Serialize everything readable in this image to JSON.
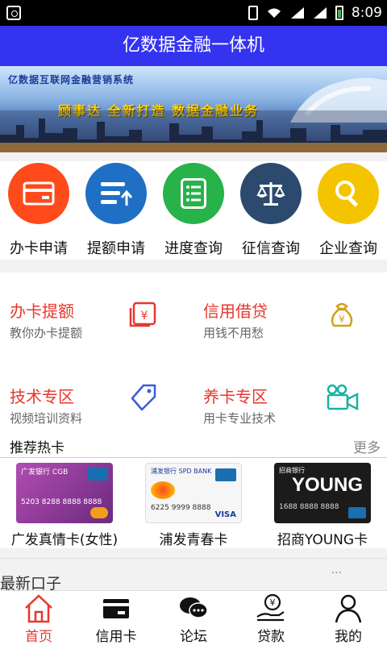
{
  "status_bar": {
    "time": "8:09"
  },
  "app_title": "亿数据金融一体机",
  "banner": {
    "title": "亿数据互联网金融营销系统",
    "slogan": "顾事达  全新打造  数据金融业务"
  },
  "quick_actions": [
    {
      "label": "办卡申请",
      "icon": "card-icon",
      "color": "#ff4a1c"
    },
    {
      "label": "提额申请",
      "icon": "raise-limit-icon",
      "color": "#1f6fc5"
    },
    {
      "label": "进度查询",
      "icon": "list-icon",
      "color": "#27b24a"
    },
    {
      "label": "征信查询",
      "icon": "scale-icon",
      "color": "#2b4a6e"
    },
    {
      "label": "企业查询",
      "icon": "search-icon",
      "color": "#f5c400"
    }
  ],
  "services": [
    {
      "title": "办卡提额",
      "subtitle": "教你办卡提额",
      "icon": "yen-card-icon",
      "icon_color": "#e8362c"
    },
    {
      "title": "信用借贷",
      "subtitle": "用钱不用愁",
      "icon": "money-bag-icon",
      "icon_color": "#d4a017"
    },
    {
      "title": "技术专区",
      "subtitle": "视频培训资料",
      "icon": "tag-icon",
      "icon_color": "#3a5bd9"
    },
    {
      "title": "养卡专区",
      "subtitle": "用卡专业技术",
      "icon": "video-camera-icon",
      "icon_color": "#18b3a0"
    }
  ],
  "recommended": {
    "title": "推荐热卡",
    "more": "更多",
    "cards": [
      {
        "name": "广发真情卡(女性)",
        "bank": "广发银行 CGB",
        "number": "5203 8288 8888 8888",
        "color": "#9a3b9a"
      },
      {
        "name": "浦发青春卡",
        "bank": "浦发银行 SPD BANK",
        "number": "6225 9999 8888",
        "color": "#f4f4f4"
      },
      {
        "name": "招商YOUNG卡",
        "bank": "招商银行",
        "number": "1688 8888 8888",
        "color": "#1b1b1b"
      }
    ]
  },
  "latest": {
    "title": "最新口子",
    "dots": "..."
  },
  "tabs": [
    {
      "label": "首页",
      "icon": "home-icon",
      "active": true
    },
    {
      "label": "信用卡",
      "icon": "credit-card-icon",
      "active": false
    },
    {
      "label": "论坛",
      "icon": "chat-icon",
      "active": false
    },
    {
      "label": "贷款",
      "icon": "loan-icon",
      "active": false
    },
    {
      "label": "我的",
      "icon": "user-icon",
      "active": false
    }
  ]
}
